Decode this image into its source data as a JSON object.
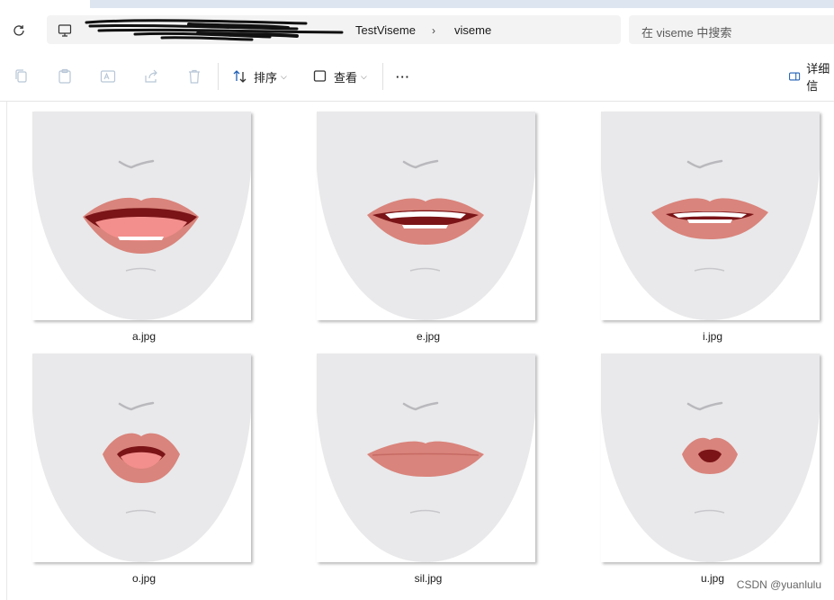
{
  "address": {
    "segments": [
      "TestViseme",
      "viseme"
    ],
    "separator": "›"
  },
  "search": {
    "placeholder": "在 viseme 中搜索"
  },
  "toolbar": {
    "sort_label": "排序",
    "view_label": "查看",
    "more_label": "···",
    "details_label": "详细信"
  },
  "files": [
    {
      "name": "a.jpg",
      "mouth": "a"
    },
    {
      "name": "e.jpg",
      "mouth": "e"
    },
    {
      "name": "i.jpg",
      "mouth": "i"
    },
    {
      "name": "o.jpg",
      "mouth": "o"
    },
    {
      "name": "sil.jpg",
      "mouth": "sil"
    },
    {
      "name": "u.jpg",
      "mouth": "u"
    }
  ],
  "watermark": "CSDN @yuanlulu",
  "colors": {
    "face": "#e9e9eb",
    "lip": "#d9847c",
    "lip_light": "#ea9b94",
    "mouth_dark": "#7a1417",
    "tongue": "#f38f8d",
    "teeth": "#ffffff",
    "accent": "#1f5fb4"
  }
}
